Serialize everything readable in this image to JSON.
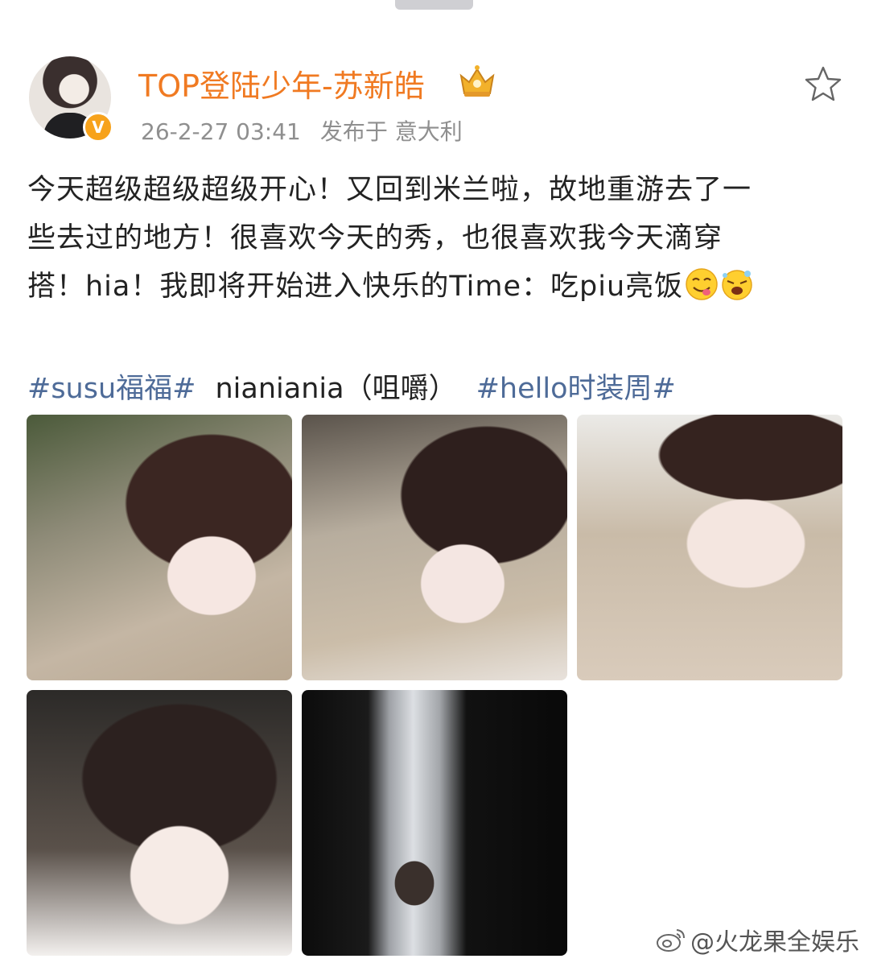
{
  "post": {
    "username": "TOP登陆少年-苏新皓",
    "timestamp": "26-2-27 03:41",
    "location": "发布于 意大利",
    "verified_badge": "V",
    "text_lines": [
      "今天超级超级超级开心！又回到米兰啦，故地重游去了一",
      "些去过的地方！很喜欢今天的秀，也很喜欢我今天滴穿",
      "搭！hia！我即将开始进入快乐的Time：吃piu亮饭"
    ],
    "emojis": [
      "smiling-face-icon",
      "exploding-laugh-icon"
    ],
    "tags": {
      "tag1": "#susu福福#",
      "plain": "nianiania（咀嚼）",
      "tag2": "#hello时装周#"
    },
    "photos": [
      {
        "name": "photo-1"
      },
      {
        "name": "photo-2"
      },
      {
        "name": "photo-3"
      },
      {
        "name": "photo-4"
      },
      {
        "name": "photo-5"
      }
    ]
  },
  "watermark": {
    "text": "@火龙果全娱乐",
    "icon": "weibo-icon"
  },
  "colors": {
    "username": "#f07a22",
    "tag_link": "#4e6b98",
    "meta": "#8f8f8f",
    "badge": "#f7a21b"
  }
}
